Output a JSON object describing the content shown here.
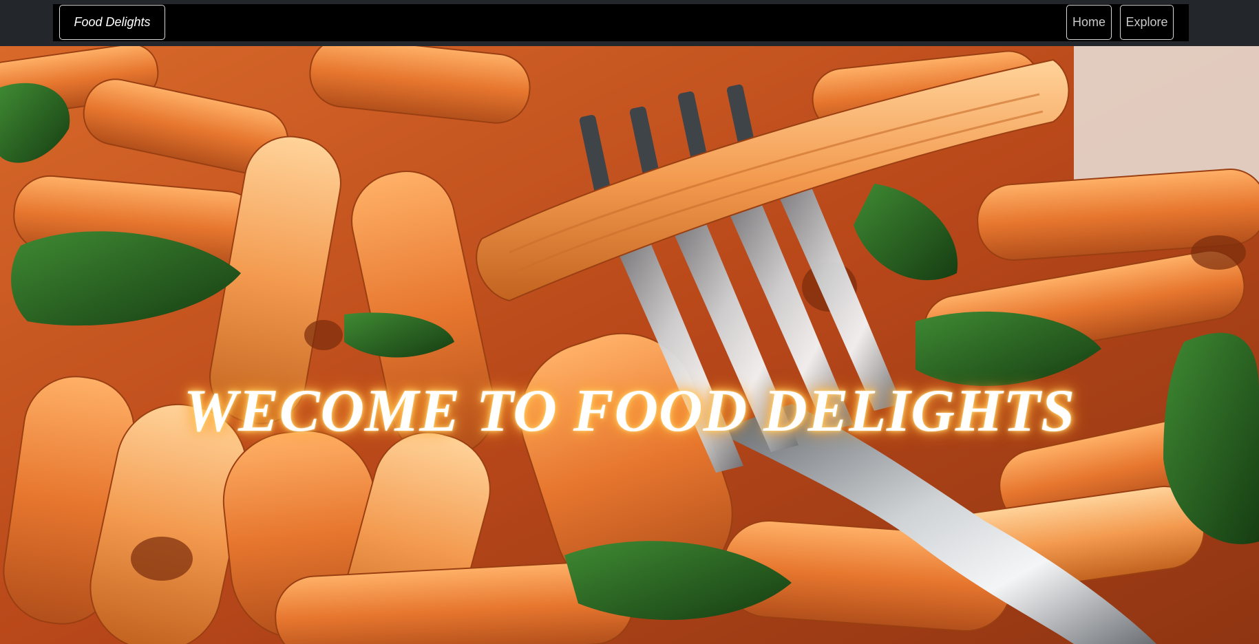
{
  "navbar": {
    "brand": "Food Delights",
    "links": [
      {
        "label": "Home"
      },
      {
        "label": "Explore"
      }
    ]
  },
  "hero": {
    "title": "WECOME TO FOOD DELIGHTS",
    "image": "penne-pasta-with-fork-photo"
  },
  "colors": {
    "topbar": "#23272b",
    "navbar": "#000000",
    "border": "#d8d8d8",
    "title_glow": "#ffb347",
    "pasta": "#e2762e",
    "spinach": "#1f5a1c"
  }
}
